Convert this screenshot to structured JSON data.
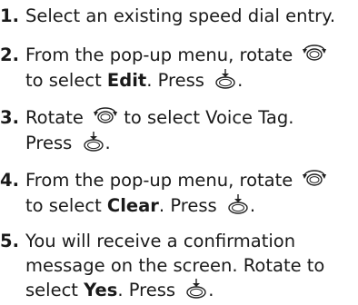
{
  "steps": [
    {
      "number": "1.",
      "line1": "Select an existing speed dial entry."
    },
    {
      "number": "2.",
      "line1": "From the pop-up menu, rotate",
      "line2a": "to select ",
      "keyword": "Edit",
      "line2b": ". Press",
      "line2c": "."
    },
    {
      "number": "3.",
      "line1": "Rotate",
      "line1b": "to select Voice Tag.",
      "line2a": "Press",
      "line2c": "."
    },
    {
      "number": "4.",
      "line1": "From the pop-up menu, rotate",
      "line2a": "to select ",
      "keyword": "Clear",
      "line2b": ". Press",
      "line2c": "."
    },
    {
      "number": "5.",
      "line1": "You will receive a confirmation",
      "line2": "message on the screen. Rotate to",
      "line3a": "select ",
      "keyword": "Yes",
      "line3b": ". Press",
      "line3c": "."
    }
  ],
  "icons": {
    "rotate": "rotate-knob-icon",
    "press": "press-knob-icon"
  }
}
